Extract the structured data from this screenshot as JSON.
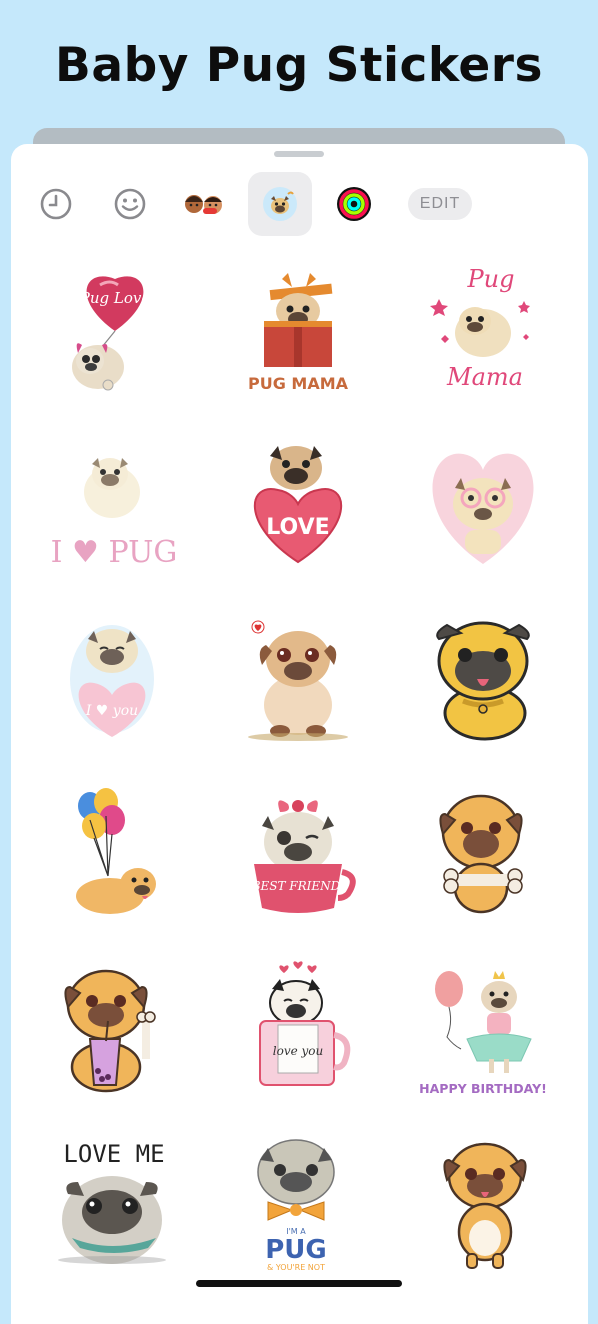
{
  "page": {
    "title": "Baby Pug Stickers"
  },
  "toolbar": {
    "items": [
      {
        "icon": "recent-clock-icon"
      },
      {
        "icon": "smiley-face-icon"
      },
      {
        "icon": "memoji-pack-icon"
      },
      {
        "icon": "pug-pack-icon",
        "selected": true
      },
      {
        "icon": "activity-rings-icon"
      }
    ],
    "edit_label": "EDIT"
  },
  "stickers": [
    {
      "name": "pug-love-balloon",
      "text": "Pug Love"
    },
    {
      "name": "pug-mama-gift-box",
      "text": "PUG MAMA"
    },
    {
      "name": "pug-mama-stars",
      "text_top": "Pug",
      "text_bottom": "Mama"
    },
    {
      "name": "i-love-pug",
      "text": "I ♥ PUG"
    },
    {
      "name": "pug-love-heart",
      "text": "LOVE"
    },
    {
      "name": "pug-glasses-heart",
      "text": ""
    },
    {
      "name": "pug-i-love-you",
      "text": "I ♥ you"
    },
    {
      "name": "pug-sitting-heart-bubble",
      "text": ""
    },
    {
      "name": "pug-tongue-out",
      "text": ""
    },
    {
      "name": "pug-balloons",
      "text": ""
    },
    {
      "name": "pug-best-friend-cup",
      "text": "BEST FRIEND"
    },
    {
      "name": "pug-bone",
      "text": ""
    },
    {
      "name": "pug-bubble-tea",
      "text": ""
    },
    {
      "name": "pug-love-you-mug",
      "text": "love you"
    },
    {
      "name": "pug-happy-birthday",
      "text": "HAPPY BIRTHDAY!"
    },
    {
      "name": "pug-love-me",
      "text": "LOVE ME"
    },
    {
      "name": "im-a-pug",
      "text_top": "I'M A",
      "text_main": "PUG",
      "text_bottom": "& YOU'RE NOT"
    },
    {
      "name": "pug-standing",
      "text": ""
    }
  ]
}
